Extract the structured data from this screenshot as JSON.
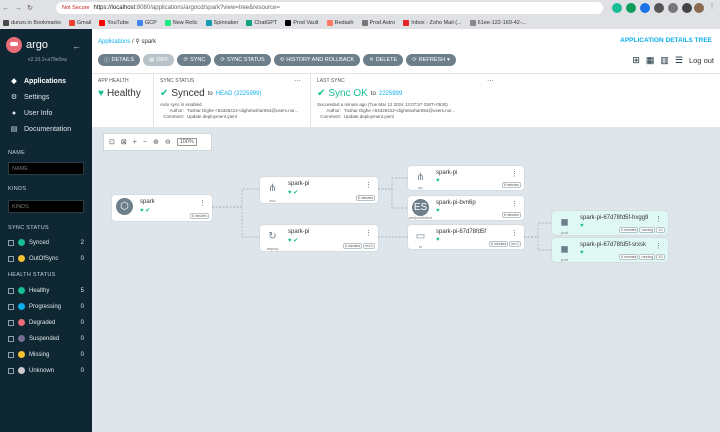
{
  "browser": {
    "security": "Not Secure",
    "url_domain": "https://localhost",
    "url_rest": ":8080/applications/argocd/spark?view=tree&resource=",
    "bookmarks": [
      {
        "label": "dunzo.in Bookmarks",
        "color": "#4a4a4a"
      },
      {
        "label": "Gmail",
        "color": "#ea4335"
      },
      {
        "label": "YouTube",
        "color": "#ff0000"
      },
      {
        "label": "GCP",
        "color": "#4285f4"
      },
      {
        "label": "New Relic",
        "color": "#1ce783"
      },
      {
        "label": "Spinnaker",
        "color": "#139bb4"
      },
      {
        "label": "ChatGPT",
        "color": "#10a37f"
      },
      {
        "label": "Prod Vault",
        "color": "#000000"
      },
      {
        "label": "Redash",
        "color": "#ff7964"
      },
      {
        "label": "Prod Astro",
        "color": "#777777"
      },
      {
        "label": "Inbox - Zoho Mail (...",
        "color": "#e42527"
      },
      {
        "label": "61ee-122-169-42-...",
        "color": "#888888"
      }
    ]
  },
  "sidebar": {
    "brand": "argo",
    "version": "v2.10.1+a79e0ea",
    "nav": [
      {
        "label": "Applications",
        "icon": "layers-icon",
        "glyph": "◆"
      },
      {
        "label": "Settings",
        "icon": "gear-icon",
        "glyph": "⚙"
      },
      {
        "label": "User Info",
        "icon": "user-icon",
        "glyph": "●"
      },
      {
        "label": "Documentation",
        "icon": "book-icon",
        "glyph": "▤"
      }
    ],
    "name_label": "NAME",
    "name_placeholder": "NAME",
    "kinds_label": "KINDS",
    "kinds_placeholder": "KINDS",
    "sync_label": "SYNC STATUS",
    "sync_items": [
      {
        "label": "Synced",
        "count": "2",
        "color": "#18be94"
      },
      {
        "label": "OutOfSync",
        "count": "0",
        "color": "#f4c030"
      }
    ],
    "health_label": "HEALTH STATUS",
    "health_items": [
      {
        "label": "Healthy",
        "count": "5",
        "color": "#18be94"
      },
      {
        "label": "Progressing",
        "count": "0",
        "color": "#0dadea"
      },
      {
        "label": "Degraded",
        "count": "0",
        "color": "#e96d76"
      },
      {
        "label": "Suspended",
        "count": "0",
        "color": "#766f94"
      },
      {
        "label": "Missing",
        "count": "0",
        "color": "#f4c030"
      },
      {
        "label": "Unknown",
        "count": "0",
        "color": "#cccccc"
      }
    ]
  },
  "header": {
    "crumb_root": "Applications",
    "crumb_sep": "/",
    "crumb_current": "spark",
    "title": "APPLICATION DETAILS TREE",
    "buttons": [
      "DETAILS",
      "DIFF",
      "SYNC",
      "SYNC STATUS",
      "HISTORY AND ROLLBACK",
      "DELETE",
      "REFRESH"
    ],
    "logout": "Log out"
  },
  "status": {
    "health_title": "APP HEALTH",
    "health_value": "Healthy",
    "sync_title": "SYNC STATUS",
    "sync_value": "Synced",
    "sync_to": "to",
    "sync_target": "HEAD (2225999)",
    "auto_sync": "Auto sync is enabled.",
    "author_label": "Author:",
    "author_value": "Tushar Dighe <64326412+dighetushar654@users.nor...",
    "comment_label": "Comment:",
    "comment_value": "Update deployment.yaml",
    "last_title": "LAST SYNC",
    "last_value": "Sync OK",
    "last_to": "to",
    "last_rev": "2225999",
    "last_time": "Succeeded a minute ago (Tue Mar 12 2024 13:07:57 GMT+0530)"
  },
  "graph": {
    "zoom": "100%",
    "nodes": [
      {
        "name": "spark",
        "kind": "",
        "tags": [
          "6 minutes"
        ]
      },
      {
        "name": "spark-pi",
        "kind": "svc",
        "tags": [
          "6 minutes"
        ]
      },
      {
        "name": "spark-pi",
        "kind": "deploy",
        "tags": [
          "6 minutes",
          "rev:1"
        ]
      },
      {
        "name": "spark-pi",
        "kind": "ep",
        "tags": [
          "6 minutes"
        ]
      },
      {
        "name": "spark-pi-bvn6p",
        "kind": "endpointslice",
        "tags": [
          "6 minutes"
        ]
      },
      {
        "name": "spark-pi-67d78fd5f",
        "kind": "rs",
        "tags": [
          "6 minutes",
          "rev:1"
        ]
      },
      {
        "name": "spark-pi-67d78fd5f-hxgg9",
        "kind": "pod",
        "tags": [
          "6 minutes",
          "running",
          "1/1"
        ]
      },
      {
        "name": "spark-pi-67d78fd5f-srxsk",
        "kind": "pod",
        "tags": [
          "6 minutes",
          "running",
          "1/1"
        ]
      }
    ]
  }
}
